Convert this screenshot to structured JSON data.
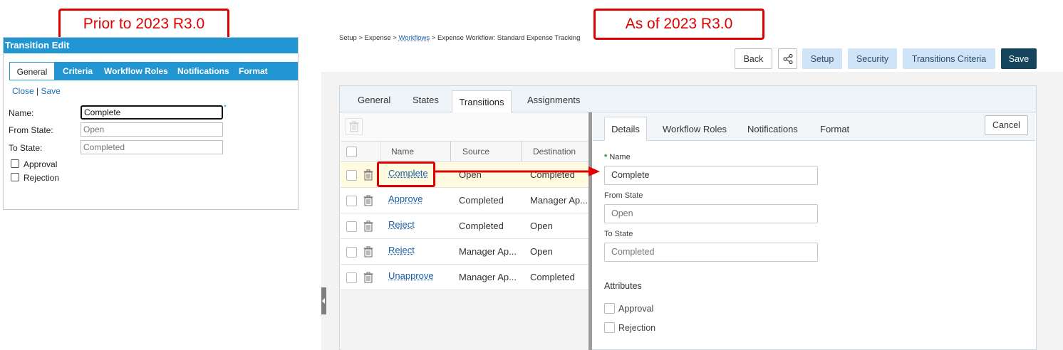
{
  "callouts": {
    "before": "Prior to 2023 R3.0",
    "after": "As of 2023 R3.0"
  },
  "old_ui": {
    "title": "Transition Edit",
    "tabs": [
      "General",
      "Criteria",
      "Workflow Roles",
      "Notifications",
      "Format"
    ],
    "actions": {
      "close": "Close",
      "separator": "|",
      "save": "Save"
    },
    "fields": {
      "name_label": "Name:",
      "name_value": "Complete",
      "required_mark": "*",
      "from_label": "From State:",
      "from_value": "Open",
      "to_label": "To State:",
      "to_value": "Completed"
    },
    "checkboxes": [
      "Approval",
      "Rejection"
    ]
  },
  "new_ui": {
    "breadcrumb": {
      "setup": "Setup",
      "sep": ">",
      "expense": "Expense",
      "workflows": "Workflows",
      "current": "Expense Workflow: Standard Expense Tracking"
    },
    "toolbar": {
      "back": "Back",
      "setup": "Setup",
      "security": "Security",
      "criteria": "Transitions Criteria",
      "save": "Save"
    },
    "tabs": [
      "General",
      "States",
      "Transitions",
      "Assignments"
    ],
    "grid": {
      "columns": [
        "Name",
        "Source",
        "Destination"
      ],
      "rows": [
        {
          "name": "Complete",
          "source": "Open",
          "destination": "Completed"
        },
        {
          "name": "Approve",
          "source": "Completed",
          "destination": "Manager Ap..."
        },
        {
          "name": "Reject",
          "source": "Completed",
          "destination": "Open"
        },
        {
          "name": "Reject",
          "source": "Manager Ap...",
          "destination": "Open"
        },
        {
          "name": "Unapprove",
          "source": "Manager Ap...",
          "destination": "Completed"
        }
      ]
    },
    "detail": {
      "tabs": [
        "Details",
        "Workflow Roles",
        "Notifications",
        "Format"
      ],
      "cancel": "Cancel",
      "required_mark": "*",
      "name_label": "Name",
      "name_value": "Complete",
      "from_label": "From State",
      "from_placeholder": "Open",
      "to_label": "To State",
      "to_placeholder": "Completed",
      "attributes_label": "Attributes",
      "attributes": [
        "Approval",
        "Rejection"
      ]
    }
  },
  "colors": {
    "callout": "#e00000",
    "old_header": "#2196d3",
    "save_button": "#15455c",
    "light_button": "#cfe4f7"
  }
}
